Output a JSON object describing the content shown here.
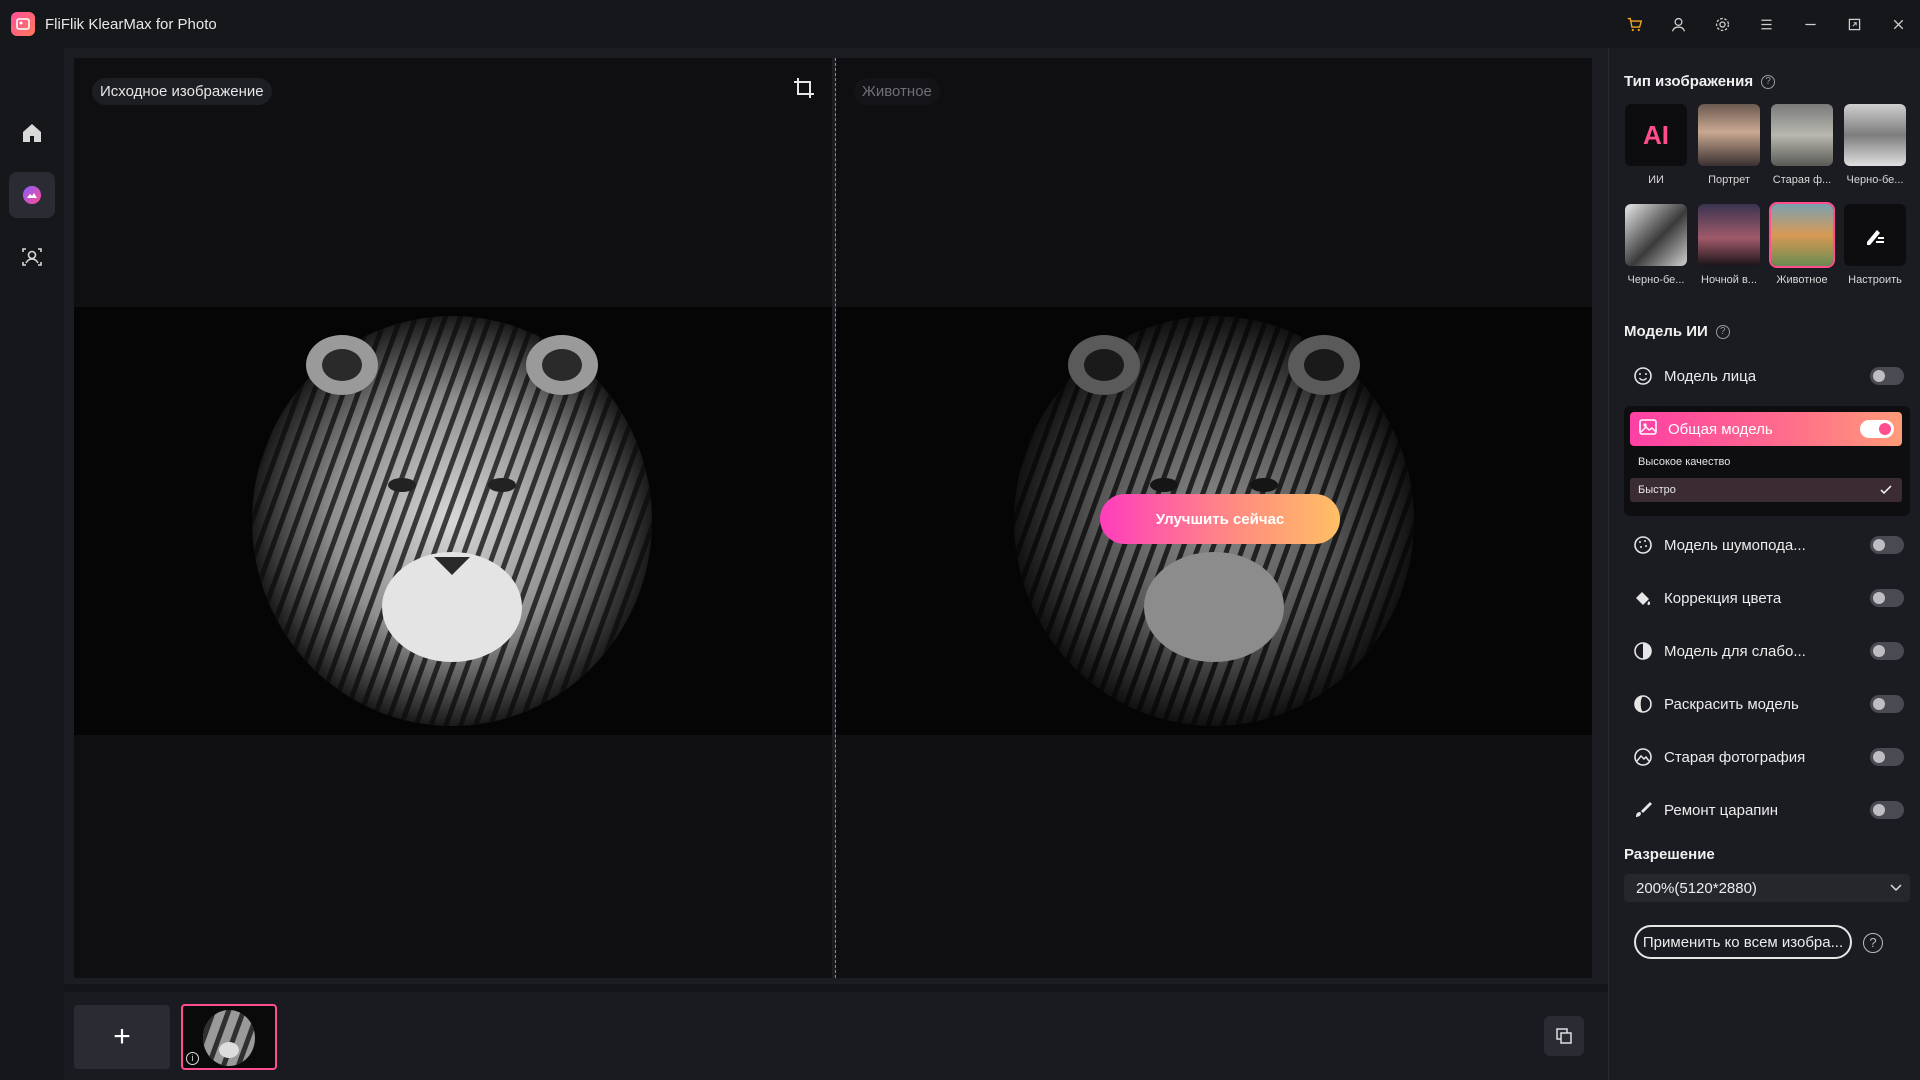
{
  "app": {
    "title": "FliFlik KlearMax for Photo"
  },
  "workspace": {
    "original_label": "Исходное изображение",
    "result_label": "Животное",
    "enhance_button": "Улучшить сейчас"
  },
  "image_type": {
    "title": "Тип изображения",
    "ai_tile_text": "AI",
    "items": [
      {
        "label": "ИИ"
      },
      {
        "label": "Портрет"
      },
      {
        "label": "Старая ф..."
      },
      {
        "label": "Черно-бе..."
      },
      {
        "label": "Черно-бе..."
      },
      {
        "label": "Ночной в..."
      },
      {
        "label": "Животное"
      },
      {
        "label": "Настроить"
      }
    ]
  },
  "ai_model": {
    "title": "Модель ИИ",
    "face": {
      "label": "Модель лица",
      "on": false
    },
    "general": {
      "label": "Общая модель",
      "on": true,
      "options": [
        "Высокое качество",
        "Быстро"
      ],
      "selected": "Быстро"
    },
    "items": [
      {
        "label": "Модель шумопода...",
        "on": false
      },
      {
        "label": "Коррекция цвета",
        "on": false
      },
      {
        "label": "Модель для слабо...",
        "on": false
      },
      {
        "label": "Раскрасить модель",
        "on": false
      },
      {
        "label": "Старая фотография",
        "on": false
      },
      {
        "label": "Ремонт царапин",
        "on": false
      }
    ]
  },
  "resolution": {
    "title": "Разрешение",
    "value": "200%(5120*2880)"
  },
  "apply_all": {
    "label": "Применить ко всем изобра..."
  },
  "bottom": {
    "add_label": "+"
  },
  "colors": {
    "accent": "#ff4d8d",
    "cart": "#f5a623"
  }
}
